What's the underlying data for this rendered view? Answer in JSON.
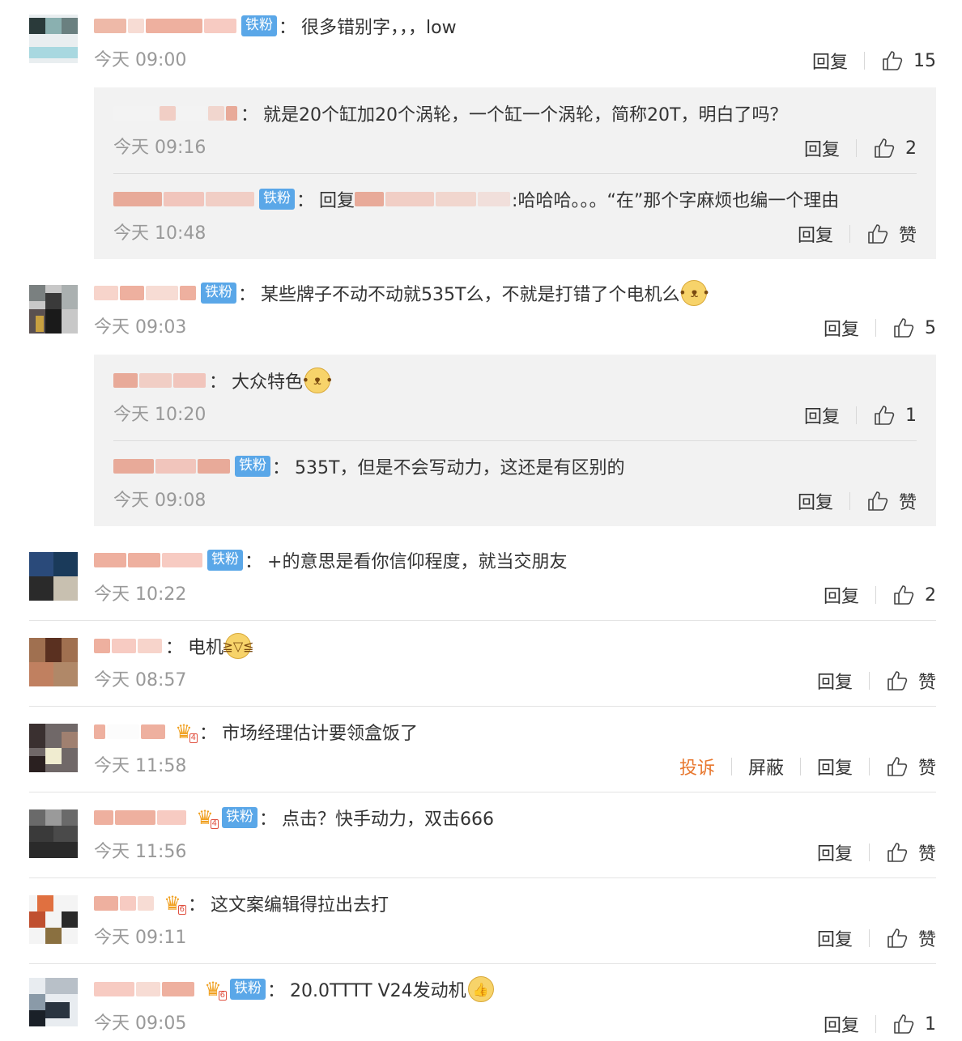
{
  "labels": {
    "reply": "回复",
    "report": "投诉",
    "block": "屏蔽",
    "like": "赞",
    "badge": "铁粉",
    "colon": "："
  },
  "comments": [
    {
      "text": "很多错别字，，，low",
      "time": "今天 09:00",
      "likes": "15"
    },
    {
      "text": "就是20个缸加20个涡轮，一个缸一个涡轮，简称20T，明白了吗？",
      "time": "今天 09:16",
      "likes": "2"
    },
    {
      "reply_prefix": "回复",
      "text": ":哈哈哈。。。“在”那个字麻烦也编一个理由",
      "time": "今天 10:48",
      "likes": "赞"
    },
    {
      "text": "某些牌子不动不动就535T么，不就是打错了个电机么",
      "time": "今天 09:03",
      "likes": "5"
    },
    {
      "text": "大众特色",
      "time": "今天 10:20",
      "likes": "1"
    },
    {
      "text": "535T，但是不会写动力，这还是有区别的",
      "time": "今天 09:08",
      "likes": "赞"
    },
    {
      "text": "+的意思是看你信仰程度，就当交朋友",
      "time": "今天 10:22",
      "likes": "2"
    },
    {
      "text": "电机",
      "time": "今天 08:57",
      "likes": "赞"
    },
    {
      "text": "市场经理估计要领盒饭了",
      "time": "今天 11:58",
      "likes": "赞"
    },
    {
      "text": "点击？快手动力，双击666",
      "time": "今天 11:56",
      "likes": "赞"
    },
    {
      "text": "这文案编辑得拉出去打",
      "time": "今天 09:11",
      "likes": "赞"
    },
    {
      "text": "20.0TTTT V24发动机",
      "time": "今天 09:05",
      "likes": "1"
    }
  ],
  "colors": {
    "badge": "#5aa7e8",
    "report": "#e8772e",
    "time": "#999999",
    "reply_bg": "#f2f2f2"
  },
  "icons": {
    "like": "thumbs-up-icon",
    "crown": "vip-crown-icon",
    "emoji_doge": "doge-emoji-icon",
    "emoji_laugh": "laugh-cry-emoji-icon",
    "emoji_thumb": "thumbs-up-emoji-icon"
  }
}
